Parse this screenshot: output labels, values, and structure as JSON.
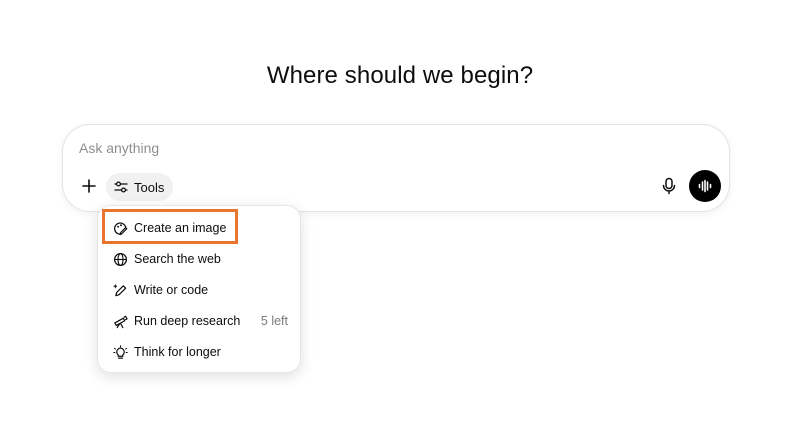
{
  "headline": "Where should we begin?",
  "composer": {
    "placeholder": "Ask anything",
    "value": "",
    "tools_label": "Tools"
  },
  "icons": {
    "plus": "plus-icon",
    "tools": "sliders-icon",
    "mic": "microphone-icon",
    "voice": "voice-waveform-icon"
  },
  "tools_menu": {
    "items": [
      {
        "label": "Create an image",
        "icon": "image-brush-icon",
        "meta": ""
      },
      {
        "label": "Search the web",
        "icon": "globe-icon",
        "meta": ""
      },
      {
        "label": "Write or code",
        "icon": "pencil-sparkle-icon",
        "meta": ""
      },
      {
        "label": "Run deep research",
        "icon": "telescope-icon",
        "meta": "5 left"
      },
      {
        "label": "Think for longer",
        "icon": "lightbulb-icon",
        "meta": ""
      }
    ]
  },
  "colors": {
    "highlight": "#e8742d",
    "voice_button": "#000000",
    "tools_chip": "#f1f1f1"
  }
}
